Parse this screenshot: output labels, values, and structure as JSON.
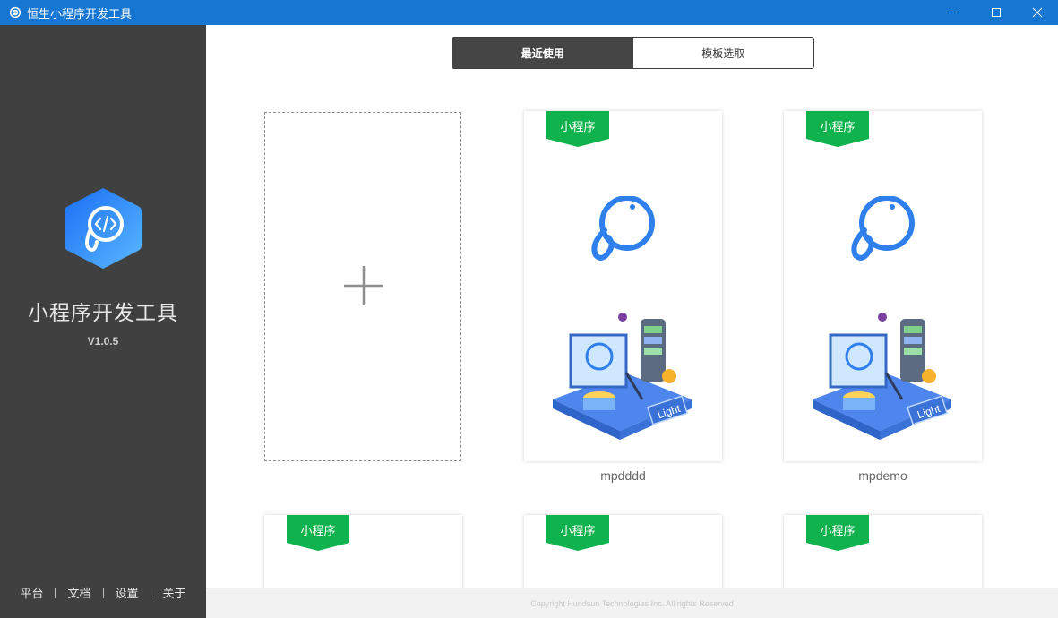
{
  "window": {
    "title": "恒生小程序开发工具",
    "minimize_glyph": "—",
    "maximize_glyph": "☐",
    "close_glyph": "✕"
  },
  "sidebar": {
    "app_name": "小程序开发工具",
    "version": "V1.0.5",
    "links": [
      "平台",
      "文档",
      "设置",
      "关于"
    ]
  },
  "tabs": [
    {
      "label": "最近使用",
      "active": true
    },
    {
      "label": "模板选取",
      "active": false
    }
  ],
  "projects": [
    {
      "tag": "小程序",
      "name": "mpdddd"
    },
    {
      "tag": "小程序",
      "name": "mpdemo"
    },
    {
      "tag": "小程序",
      "name": ""
    },
    {
      "tag": "小程序",
      "name": ""
    },
    {
      "tag": "小程序",
      "name": ""
    }
  ],
  "new_project_icon": "plus-icon",
  "illustration_badge": "Light",
  "copyright": "Copyright Hundsun Technologies Inc. All rights Reserved",
  "colors": {
    "titlebar": "#1676d2",
    "sidebar": "#404040",
    "ribbon_green": "#0fb24c",
    "logo_blue": "#2f80ed",
    "active_tab": "#454545"
  }
}
